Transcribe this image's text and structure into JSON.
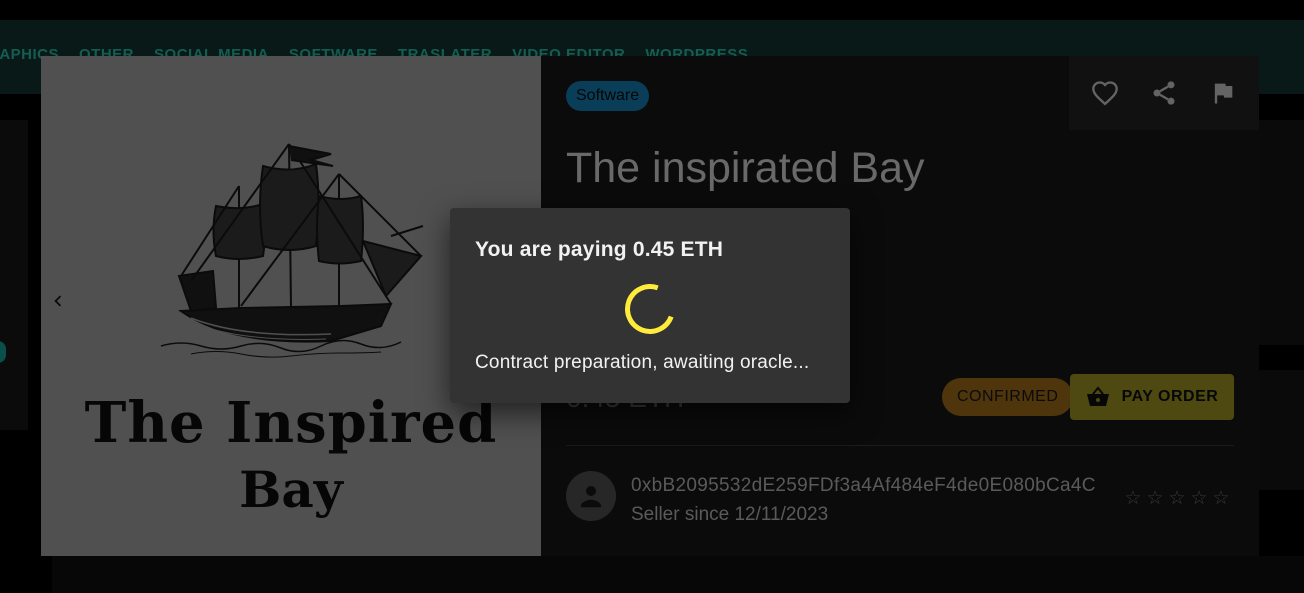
{
  "background": {
    "nav_categories": [
      "RAPHICS",
      "OTHER",
      "SOCIAL MEDIA",
      "SOFTWARE",
      "TRASLATER",
      "VIDEO EDITOR",
      "WORDPRESS"
    ]
  },
  "gallery": {
    "image_title_line1": "The Inspired",
    "image_title_line2": "Bay",
    "prev_icon": "chevron-left-icon"
  },
  "product": {
    "category": "Software",
    "title": "The inspirated Bay",
    "price": "0.45 ETH",
    "status": "CONFIRMED",
    "pay_label": "PAY ORDER",
    "actions": [
      "heart-icon",
      "share-icon",
      "flag-icon"
    ]
  },
  "seller": {
    "address": "0xbB2095532dE259FDf3a4Af484eF4de0E080bCa4C",
    "since": "Seller since 12/11/2023",
    "rating_stars": 0,
    "rating_max": 5
  },
  "dialog": {
    "title": "You are paying 0.45 ETH",
    "message": "Contract preparation, awaiting oracle..."
  },
  "colors": {
    "accent_status": "#f59e0b",
    "accent_pay": "#ffeb3b",
    "category_chip": "#1e88e5",
    "spinner": "#ffeb3b"
  }
}
